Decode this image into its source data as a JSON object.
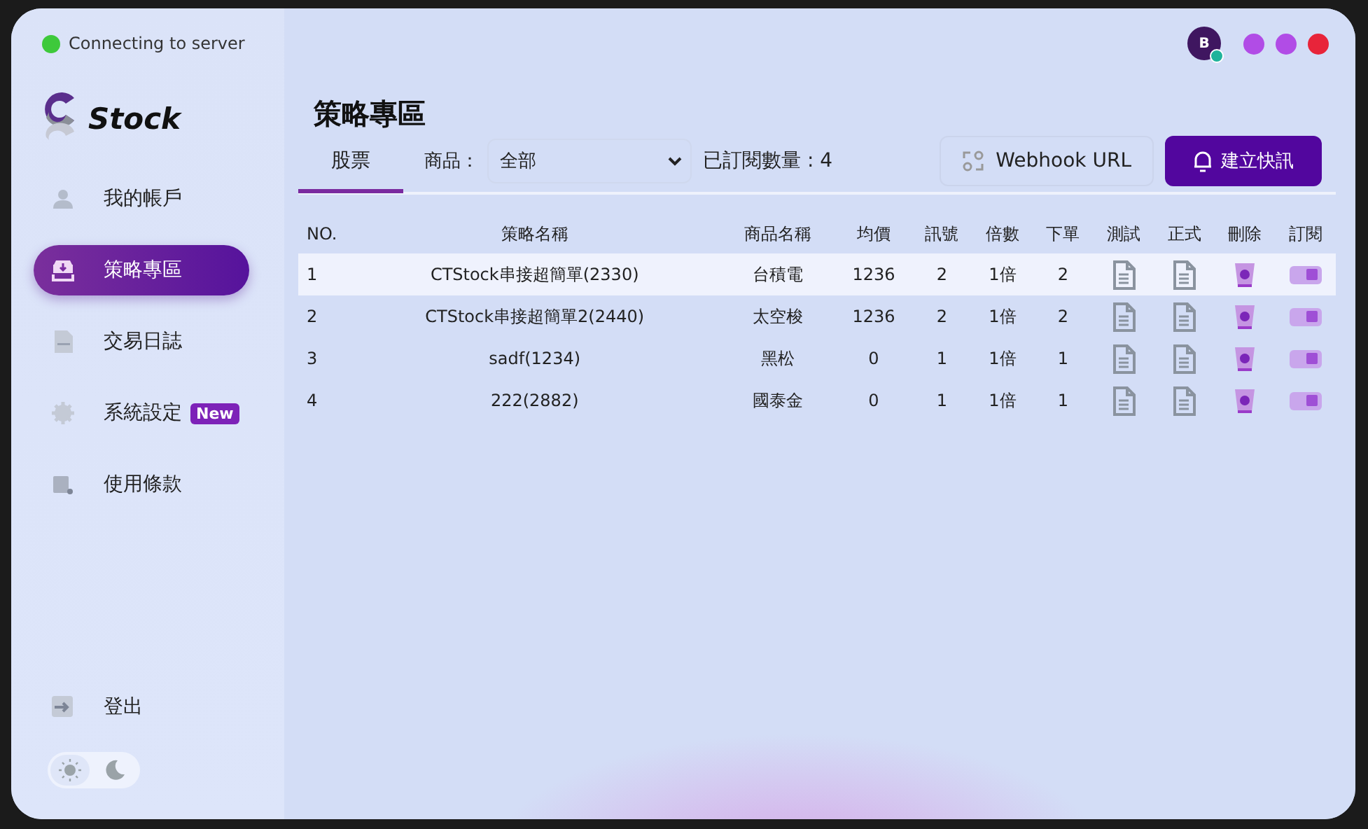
{
  "status": {
    "text": "Connecting to server",
    "connected": true
  },
  "logo": {
    "text": "Stock"
  },
  "nav": [
    {
      "label": "我的帳戶",
      "kind": "user",
      "selected": false
    },
    {
      "label": "策略專區",
      "kind": "download",
      "selected": true
    },
    {
      "label": "交易日誌",
      "kind": "log",
      "selected": false
    },
    {
      "label": "系統設定",
      "kind": "gear",
      "selected": false,
      "badge": "New"
    },
    {
      "label": "使用條款",
      "kind": "scroll",
      "selected": false
    }
  ],
  "logout": {
    "label": "登出"
  },
  "theme_toggle": [
    {
      "kind": "sun",
      "selected": true
    },
    {
      "kind": "moon",
      "selected": false
    }
  ],
  "avatar": {
    "initial": "B",
    "online": true
  },
  "page_title": "策略專區",
  "tabs": [
    {
      "label": "股票",
      "selected": true
    }
  ],
  "filter": {
    "label": "商品：",
    "value": "全部"
  },
  "subscribed_count": "已訂閱數量 : 4",
  "buttons": {
    "webhook": "Webhook URL",
    "create": "建立快訊"
  },
  "table": {
    "columns": [
      "NO.",
      "策略名稱",
      "商品名稱",
      "均價",
      "訊號",
      "倍數",
      "下單",
      "測試",
      "正式",
      "刪除",
      "訂閱"
    ],
    "rows": [
      {
        "no": "1",
        "name": "CTStock串接超簡單(2330)",
        "product": "台積電",
        "avg": "1236",
        "signal": "2",
        "multiple": "1倍",
        "order": "2",
        "subscribed": true,
        "selected": true
      },
      {
        "no": "2",
        "name": "CTStock串接超簡單2(2440)",
        "product": "太空梭",
        "avg": "1236",
        "signal": "2",
        "multiple": "1倍",
        "order": "2",
        "subscribed": true,
        "selected": false
      },
      {
        "no": "3",
        "name": "sadf(1234)",
        "product": "黑松",
        "avg": "0",
        "signal": "1",
        "multiple": "1倍",
        "order": "1",
        "subscribed": true,
        "selected": false
      },
      {
        "no": "4",
        "name": "222(2882)",
        "product": "國泰金",
        "avg": "0",
        "signal": "1",
        "multiple": "1倍",
        "order": "1",
        "subscribed": true,
        "selected": false
      }
    ]
  }
}
